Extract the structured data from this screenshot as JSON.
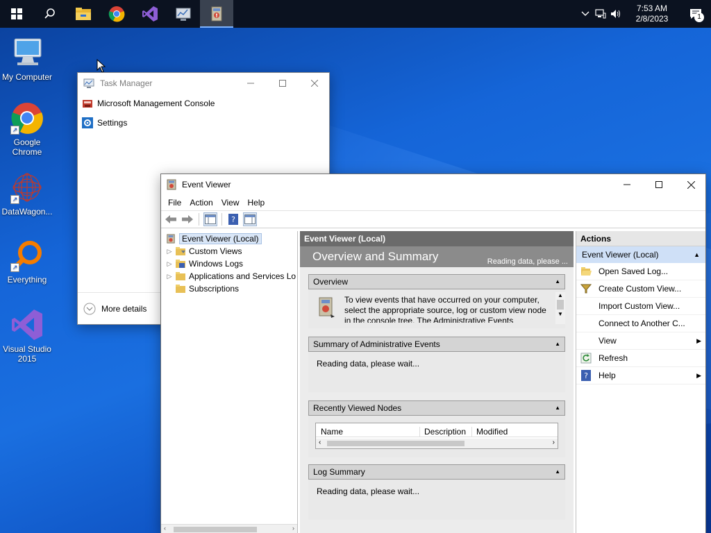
{
  "taskbar": {
    "start_icon": "windows-start-icon",
    "search_icon": "search-icon",
    "pinned": [
      "file-explorer-icon",
      "chrome-icon",
      "visual-studio-icon",
      "server-manager-icon",
      "event-viewer-icon"
    ],
    "clock_time": "7:53 AM",
    "clock_date": "2/8/2023",
    "notification_count": "1"
  },
  "desktop": {
    "icons": [
      {
        "label": "My Computer",
        "icon": "computer-icon"
      },
      {
        "label": "Google Chrome",
        "icon": "chrome-icon"
      },
      {
        "label": "DataWagon...",
        "icon": "datawagon-icon"
      },
      {
        "label": "Everything",
        "icon": "everything-icon"
      },
      {
        "label": "Visual Studio 2015",
        "icon": "visual-studio-icon"
      }
    ]
  },
  "task_manager": {
    "title": "Task Manager",
    "apps": [
      {
        "label": "Microsoft Management Console",
        "icon": "mmc-icon"
      },
      {
        "label": "Settings",
        "icon": "settings-gear-icon"
      }
    ],
    "more_details": "More details"
  },
  "event_viewer": {
    "title": "Event Viewer",
    "menu": [
      "File",
      "Action",
      "View",
      "Help"
    ],
    "tree": [
      {
        "label": "Event Viewer (Local)",
        "selected": true
      },
      {
        "label": "Custom Views"
      },
      {
        "label": "Windows Logs"
      },
      {
        "label": "Applications and Services Lo"
      },
      {
        "label": "Subscriptions"
      }
    ],
    "middle": {
      "header": "Event Viewer (Local)",
      "banner_title": "Overview and Summary",
      "banner_status": "Reading data, please ...",
      "overview_title": "Overview",
      "overview_text": "To view events that have occurred on your computer, select the appropriate source, log or custom view node in the console tree. The Administrative Events",
      "summary_title": "Summary of Administrative Events",
      "summary_text": "Reading data, please wait...",
      "recent_title": "Recently Viewed Nodes",
      "recent_columns": [
        "Name",
        "Description",
        "Modified"
      ],
      "log_title": "Log Summary",
      "log_text": "Reading data, please wait..."
    },
    "actions": {
      "header": "Actions",
      "subheader": "Event Viewer (Local)",
      "items": [
        {
          "label": "Open Saved Log...",
          "icon": "open-folder-icon"
        },
        {
          "label": "Create Custom View...",
          "icon": "filter-icon"
        },
        {
          "label": "Import Custom View...",
          "icon": ""
        },
        {
          "label": "Connect to Another C...",
          "icon": ""
        },
        {
          "label": "View",
          "icon": "",
          "submenu": true
        },
        {
          "label": "Refresh",
          "icon": "refresh-icon"
        },
        {
          "label": "Help",
          "icon": "help-icon",
          "submenu": true
        }
      ]
    }
  }
}
